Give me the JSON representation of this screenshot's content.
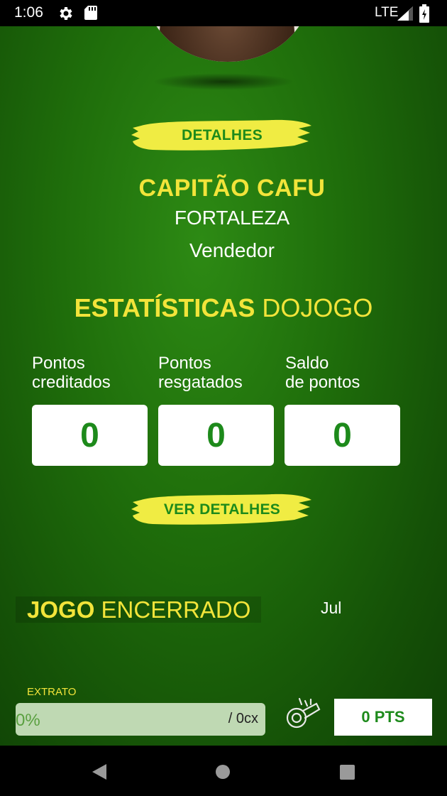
{
  "status_bar": {
    "time": "1:06",
    "network": "LTE"
  },
  "profile": {
    "details_button": "DETALHES",
    "name": "CAPITÃO CAFU",
    "city": "FORTALEZA",
    "role": "Vendedor"
  },
  "stats": {
    "title_bold": "ESTATÍSTICAS",
    "title_regular": " DOJOGO",
    "items": [
      {
        "label_line1": "Pontos",
        "label_line2": "creditados",
        "value": "0"
      },
      {
        "label_line1": "Pontos",
        "label_line2": "resgatados",
        "value": "0"
      },
      {
        "label_line1": "Saldo",
        "label_line2": "de pontos",
        "value": "0"
      }
    ],
    "details_button": "VER DETALHES"
  },
  "game": {
    "status_bold": "JOGO",
    "status_regular": " ENCERRADO",
    "month": "Jul"
  },
  "extrato": {
    "label": "EXTRATO",
    "percent_text": "0%",
    "progress_fraction": 0,
    "count_text": "/ 0cx",
    "points": "0 PTS"
  },
  "colors": {
    "accent_yellow": "#f2e43a",
    "brand_green": "#1d8a1b",
    "background_green": "#1f6e0b"
  }
}
